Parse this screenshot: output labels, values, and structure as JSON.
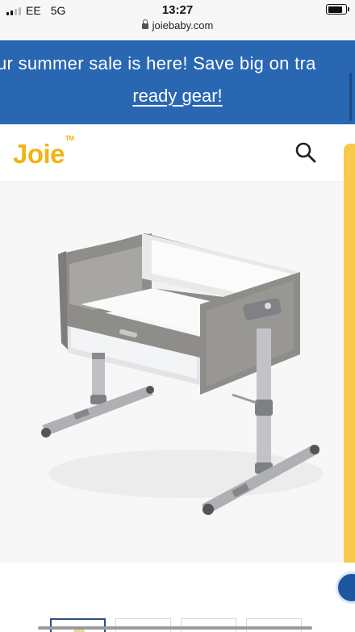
{
  "status_bar": {
    "carrier": "EE",
    "network": "5G",
    "time": "13:27",
    "url": "joiebaby.com",
    "signal_bars_active": 2,
    "signal_bars_total": 4,
    "battery_level": 0.85
  },
  "promo_banner": {
    "line1": "ur summer sale is here! Save big on tra",
    "line2": "ready gear!",
    "background_color": "#2a67b3"
  },
  "header": {
    "logo_text": "Joie",
    "logo_mark": "TM",
    "logo_color": "#f2b316",
    "search_icon": "search-icon"
  },
  "product": {
    "image_icon": "bedside-crib-image"
  },
  "thumbnails": {
    "count": 4,
    "active_index": 0
  },
  "colors": {
    "accent_yellow": "#f8c94a",
    "active_border": "#2b4f85"
  }
}
